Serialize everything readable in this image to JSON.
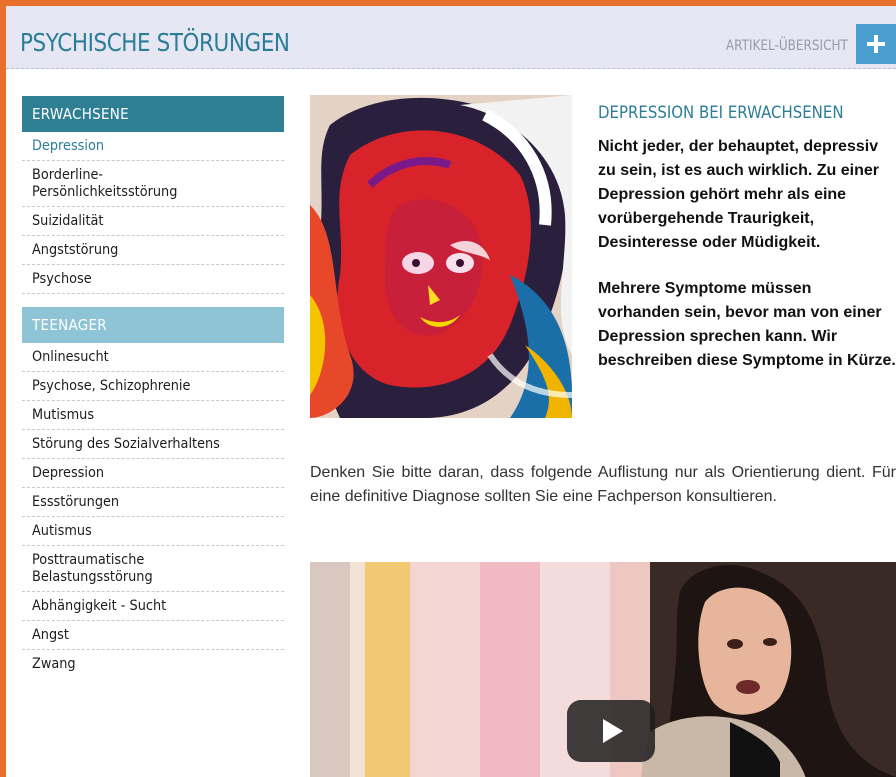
{
  "header": {
    "title": "PSYCHISCHE STÖRUNGEN",
    "overview_link": "ARTIKEL-ÜBERSICHT",
    "plus_icon": "plus-icon"
  },
  "sidebar": {
    "adult_heading": "ERWACHSENE",
    "adult_items": [
      {
        "label": "Depression",
        "active": true
      },
      {
        "label": "Borderline-\nPersönlichkeitsstörung"
      },
      {
        "label": "Suizidalität"
      },
      {
        "label": "Angststörung"
      },
      {
        "label": "Psychose"
      }
    ],
    "teen_heading": "TEENAGER",
    "teen_items": [
      {
        "label": "Onlinesucht"
      },
      {
        "label": "Psychose, Schizophrenie"
      },
      {
        "label": "Mutismus"
      },
      {
        "label": "Störung des Sozialverhaltens"
      },
      {
        "label": "Depression"
      },
      {
        "label": "Essstörungen"
      },
      {
        "label": "Autismus"
      },
      {
        "label": "Posttraumatische\nBelastungsstörung"
      },
      {
        "label": "Abhängigkeit - Sucht"
      },
      {
        "label": "Angst"
      },
      {
        "label": "Zwang"
      }
    ]
  },
  "article": {
    "title": "DEPRESSION BEI ERWACHSENEN",
    "lead_1": "Nicht jeder, der behauptet, depressiv zu sein, ist es auch wirklich. Zu einer Depression gehört mehr als eine vorübergehende Traurigkeit, Desinteresse oder Müdigkeit.",
    "lead_2": "Mehrere Symptome müssen vorhanden sein, bevor man von einer Depression sprechen kann. Wir beschreiben diese Symptome in Kürze.",
    "body": "Denken Sie bitte daran, dass folgende Auflistung nur als Orientierung dient. Für eine definitive Diagnose sollten Sie eine Fachperson konsultieren."
  },
  "video": {
    "play_icon": "play-icon"
  },
  "colors": {
    "accent": "#2b7d98",
    "frame": "#e8702a",
    "adult_heading_bg": "#2e7f93",
    "teen_heading_bg": "#8fc3d6",
    "plus_button": "#4a9fd0"
  }
}
